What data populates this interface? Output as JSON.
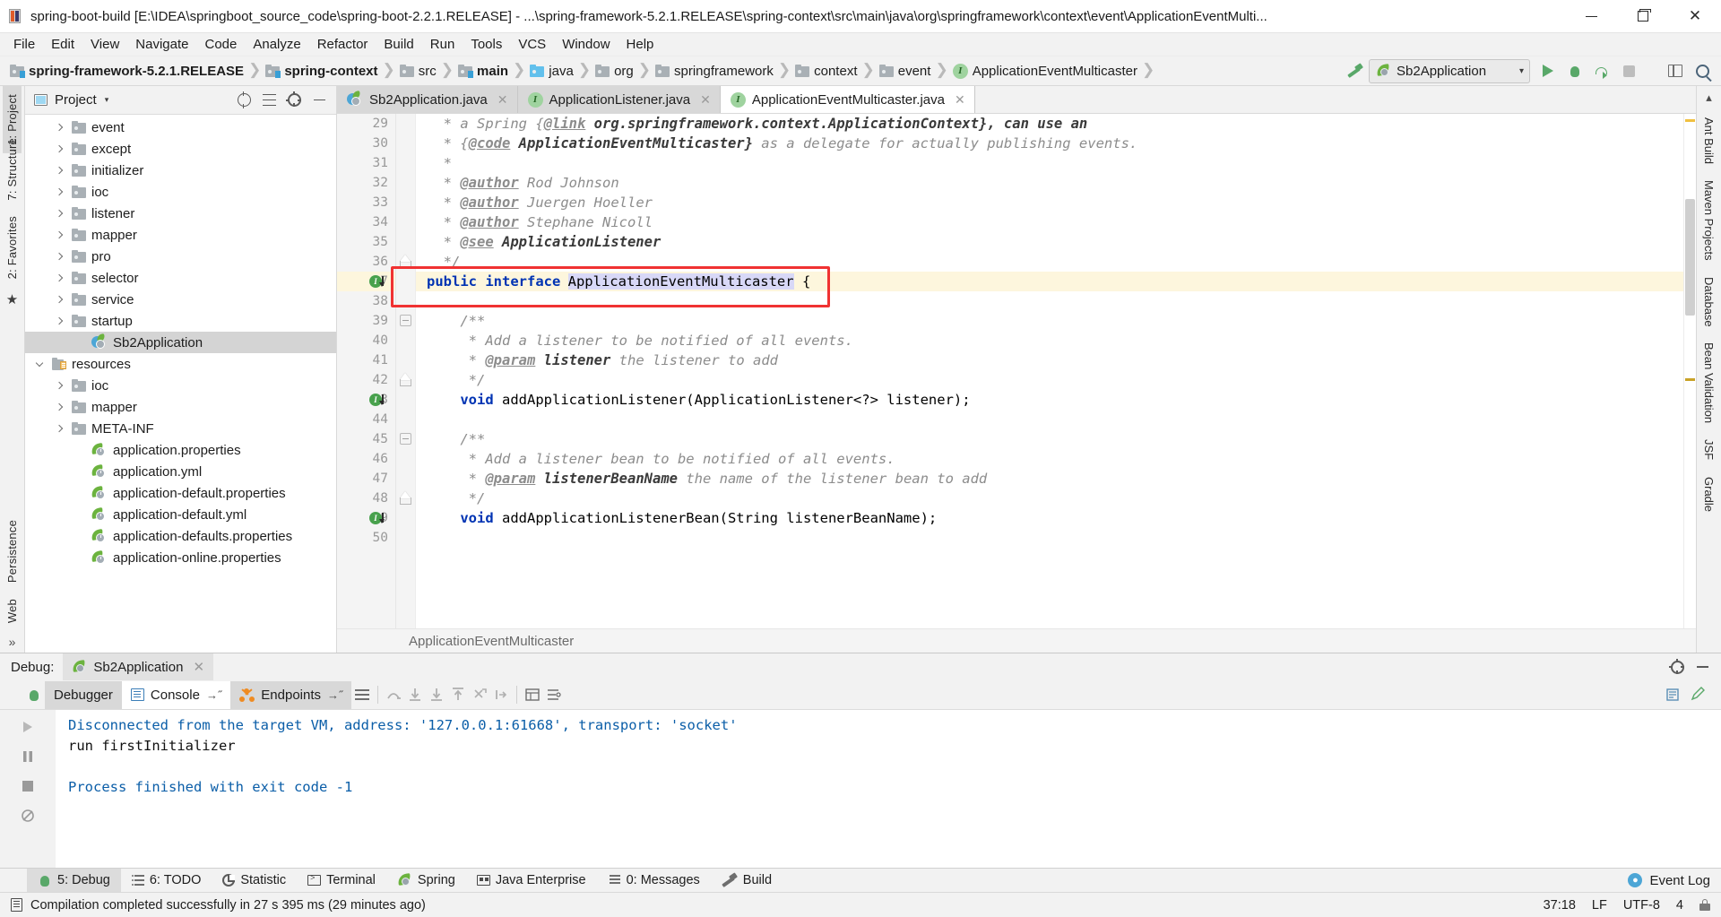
{
  "window": {
    "title": "spring-boot-build [E:\\IDEA\\springboot_source_code\\spring-boot-2.2.1.RELEASE] - ...\\spring-framework-5.2.1.RELEASE\\spring-context\\src\\main\\java\\org\\springframework\\context\\event\\ApplicationEventMulti...",
    "icon": "intellij-idea-icon",
    "minimize": "─",
    "maximize": "❐",
    "close": "✕"
  },
  "menubar": {
    "items": [
      "File",
      "Edit",
      "View",
      "Navigate",
      "Code",
      "Analyze",
      "Refactor",
      "Build",
      "Run",
      "Tools",
      "VCS",
      "Window",
      "Help"
    ]
  },
  "breadcrumb": {
    "items": [
      {
        "label": "spring-framework-5.2.1.RELEASE",
        "icon": "module-folder-icon",
        "bold": true
      },
      {
        "label": "spring-context",
        "icon": "module-folder-icon",
        "bold": true
      },
      {
        "label": "src",
        "icon": "folder-icon",
        "bold": false
      },
      {
        "label": "main",
        "icon": "module-folder-icon",
        "bold": true
      },
      {
        "label": "java",
        "icon": "source-root-folder-icon",
        "bold": false
      },
      {
        "label": "org",
        "icon": "folder-icon",
        "bold": false
      },
      {
        "label": "springframework",
        "icon": "folder-icon",
        "bold": false
      },
      {
        "label": "context",
        "icon": "folder-icon",
        "bold": false
      },
      {
        "label": "event",
        "icon": "folder-icon",
        "bold": false
      },
      {
        "label": "ApplicationEventMulticaster",
        "icon": "interface-icon",
        "bold": false
      }
    ],
    "separator": "❯"
  },
  "toolbar": {
    "build_icon": "hammer-build-icon",
    "run_config": {
      "label": "Sb2Application",
      "icon": "spring-boot-icon",
      "chevron": "▾"
    },
    "run_icon": "run-icon",
    "debug_icon": "debug-icon",
    "rerun_icon": "rerun-icon",
    "stop_icon": "stop-icon",
    "layout_icon": "layout-icon",
    "search_icon": "search-everywhere-icon"
  },
  "project_panel": {
    "title": "Project",
    "chevron": "▾",
    "window_icon": "project-window-icon",
    "locate_icon": "scroll-from-source-icon",
    "collapse_icon": "collapse-all-icon",
    "hide_icon": "hide-panel-icon",
    "tree": [
      {
        "label": "event",
        "icon": "folder-icon",
        "arrow": "right",
        "indent": 3,
        "selected": false
      },
      {
        "label": "except",
        "icon": "folder-icon",
        "arrow": "right",
        "indent": 3,
        "selected": false
      },
      {
        "label": "initializer",
        "icon": "folder-icon",
        "arrow": "right",
        "indent": 3,
        "selected": false
      },
      {
        "label": "ioc",
        "icon": "folder-icon",
        "arrow": "right",
        "indent": 3,
        "selected": false
      },
      {
        "label": "listener",
        "icon": "folder-icon",
        "arrow": "right",
        "indent": 3,
        "selected": false
      },
      {
        "label": "mapper",
        "icon": "folder-icon",
        "arrow": "right",
        "indent": 3,
        "selected": false
      },
      {
        "label": "pro",
        "icon": "folder-icon",
        "arrow": "right",
        "indent": 3,
        "selected": false
      },
      {
        "label": "selector",
        "icon": "folder-icon",
        "arrow": "right",
        "indent": 3,
        "selected": false
      },
      {
        "label": "service",
        "icon": "folder-icon",
        "arrow": "right",
        "indent": 3,
        "selected": false
      },
      {
        "label": "startup",
        "icon": "folder-icon",
        "arrow": "right",
        "indent": 3,
        "selected": false
      },
      {
        "label": "Sb2Application",
        "icon": "spring-boot-class-icon",
        "arrow": "none",
        "indent": 4,
        "selected": true
      },
      {
        "label": "resources",
        "icon": "resources-folder-icon",
        "arrow": "down",
        "indent": 2,
        "selected": false
      },
      {
        "label": "ioc",
        "icon": "folder-icon",
        "arrow": "right",
        "indent": 3,
        "selected": false
      },
      {
        "label": "mapper",
        "icon": "folder-icon",
        "arrow": "right",
        "indent": 3,
        "selected": false
      },
      {
        "label": "META-INF",
        "icon": "folder-icon",
        "arrow": "right",
        "indent": 3,
        "selected": false
      },
      {
        "label": "application.properties",
        "icon": "spring-config-icon",
        "arrow": "none",
        "indent": 4,
        "selected": false
      },
      {
        "label": "application.yml",
        "icon": "spring-config-icon",
        "arrow": "none",
        "indent": 4,
        "selected": false
      },
      {
        "label": "application-default.properties",
        "icon": "spring-config-icon",
        "arrow": "none",
        "indent": 4,
        "selected": false
      },
      {
        "label": "application-default.yml",
        "icon": "spring-config-icon",
        "arrow": "none",
        "indent": 4,
        "selected": false
      },
      {
        "label": "application-defaults.properties",
        "icon": "spring-config-icon",
        "arrow": "none",
        "indent": 4,
        "selected": false
      },
      {
        "label": "application-online.properties",
        "icon": "spring-config-icon",
        "arrow": "none",
        "indent": 4,
        "selected": false
      }
    ]
  },
  "left_strip": {
    "top": [
      {
        "label": "1: Project",
        "icon": "project-icon",
        "active": true
      }
    ],
    "bottom": [
      {
        "label": "2: Favorites",
        "icon": "favorites-icon",
        "active": false
      },
      {
        "label": "7: Structure",
        "icon": "structure-icon",
        "active": false
      }
    ]
  },
  "left_strip_lower": [
    {
      "label": "Persistence",
      "icon": "persistence-icon"
    },
    {
      "label": "Web",
      "icon": "web-icon"
    }
  ],
  "right_strip": [
    {
      "label": "Ant Build",
      "icon": "ant-icon"
    },
    {
      "label": "Maven Projects",
      "icon": "maven-icon"
    },
    {
      "label": "Database",
      "icon": "database-icon"
    },
    {
      "label": "Bean Validation",
      "icon": "bean-validation-icon"
    },
    {
      "label": "JSF",
      "icon": "jsf-icon"
    },
    {
      "label": "Gradle",
      "icon": "gradle-icon"
    }
  ],
  "editor": {
    "tabs": [
      {
        "label": "Sb2Application.java",
        "icon": "spring-boot-class-icon",
        "active": false,
        "close": "✕"
      },
      {
        "label": "ApplicationListener.java",
        "icon": "interface-icon",
        "active": false,
        "close": "✕"
      },
      {
        "label": "ApplicationEventMulticaster.java",
        "icon": "interface-icon",
        "active": true,
        "close": "✕"
      }
    ],
    "first_line_number": 29,
    "lines": [
      {
        "n": 29,
        "html": "  <span class='cm'>* a Spring {</span><span class='tag'>@link</span><span class='cmb'> org.springframework.context.ApplicationContext}, can use an</span>",
        "highlight": false,
        "gutter": ""
      },
      {
        "n": 30,
        "html": "  <span class='cm'>* {</span><span class='tag'>@code</span><span class='cmb'> ApplicationEventMulticaster}</span><span class='cm'> as a delegate for actually publishing events.</span>",
        "highlight": false,
        "gutter": ""
      },
      {
        "n": 31,
        "html": "  <span class='cm'>*</span>",
        "highlight": false,
        "gutter": ""
      },
      {
        "n": 32,
        "html": "  <span class='cm'>* </span><span class='tag'>@author</span><span class='cm'> Rod Johnson</span>",
        "highlight": false,
        "gutter": ""
      },
      {
        "n": 33,
        "html": "  <span class='cm'>* </span><span class='tag'>@author</span><span class='cm'> Juergen Hoeller</span>",
        "highlight": false,
        "gutter": ""
      },
      {
        "n": 34,
        "html": "  <span class='cm'>* </span><span class='tag'>@author</span><span class='cm'> Stephane Nicoll</span>",
        "highlight": false,
        "gutter": ""
      },
      {
        "n": 35,
        "html": "  <span class='cm'>* </span><span class='tag'>@see</span><span class='cmb'> ApplicationListener</span>",
        "highlight": false,
        "gutter": ""
      },
      {
        "n": 36,
        "html": "  <span class='cm'>*/</span>",
        "highlight": false,
        "gutter": "foldB"
      },
      {
        "n": 37,
        "html": "<span class='kw'>public interface </span><span class='caret'></span><span class='ident-hl'>ApplicationEventMulticaster</span> {",
        "highlight": true,
        "gutter": "impl"
      },
      {
        "n": 38,
        "html": "",
        "highlight": false,
        "gutter": ""
      },
      {
        "n": 39,
        "html": "    <span class='cm'>/**</span>",
        "highlight": false,
        "gutter": "foldT"
      },
      {
        "n": 40,
        "html": "     <span class='cm'>* Add a listener to be notified of all events.</span>",
        "highlight": false,
        "gutter": ""
      },
      {
        "n": 41,
        "html": "     <span class='cm'>* </span><span class='tag'>@param</span><span class='cmb'> listener</span><span class='cm'> the listener to add</span>",
        "highlight": false,
        "gutter": ""
      },
      {
        "n": 42,
        "html": "     <span class='cm'>*/</span>",
        "highlight": false,
        "gutter": "foldB"
      },
      {
        "n": 43,
        "html": "    <span class='kw'>void </span>addApplicationListener(ApplicationListener&lt;?&gt; listener);",
        "highlight": false,
        "gutter": "impl"
      },
      {
        "n": 44,
        "html": "",
        "highlight": false,
        "gutter": ""
      },
      {
        "n": 45,
        "html": "    <span class='cm'>/**</span>",
        "highlight": false,
        "gutter": "foldT"
      },
      {
        "n": 46,
        "html": "     <span class='cm'>* Add a listener bean to be notified of all events.</span>",
        "highlight": false,
        "gutter": ""
      },
      {
        "n": 47,
        "html": "     <span class='cm'>* </span><span class='tag'>@param</span><span class='cmb'> listenerBeanName</span><span class='cm'> the name of the listener bean to add</span>",
        "highlight": false,
        "gutter": ""
      },
      {
        "n": 48,
        "html": "     <span class='cm'>*/</span>",
        "highlight": false,
        "gutter": "foldB"
      },
      {
        "n": 49,
        "html": "    <span class='kw'>void </span>addApplicationListenerBean(String listenerBeanName);",
        "highlight": false,
        "gutter": "impl"
      },
      {
        "n": 50,
        "html": "",
        "highlight": false,
        "gutter": ""
      }
    ],
    "breadcrumb_bottom": "ApplicationEventMulticaster",
    "highlight_box_color": "#f03232",
    "implemented_marker": "I"
  },
  "debug": {
    "label": "Debug:",
    "session_tab": {
      "label": "Sb2Application",
      "icon": "spring-boot-icon",
      "close": "✕"
    },
    "settings_icon": "settings-icon",
    "hide_icon": "hide-icon",
    "tabs": [
      {
        "label": "Debugger",
        "icon": "",
        "state": "sel"
      },
      {
        "label": "Console",
        "icon": "console-icon",
        "state": "white",
        "pin": "→˝"
      },
      {
        "label": "Endpoints",
        "icon": "endpoints-icon",
        "state": "sel",
        "pin": "→˝"
      }
    ],
    "console_lines": [
      {
        "text": "Disconnected from the target VM, address: '127.0.0.1:61668', transport: 'socket'",
        "color": "blue"
      },
      {
        "text": "run firstInitializer",
        "color": "black"
      },
      {
        "text": "",
        "color": "black"
      },
      {
        "text": "Process finished with exit code -1",
        "color": "blue"
      }
    ],
    "side_icons": [
      "debug-icon",
      "rerun-icon",
      "resume-icon",
      "stop-icon",
      "mute-breakpoints-icon"
    ]
  },
  "bottom_tabs": [
    {
      "label": "5: Debug",
      "icon": "debug-icon",
      "active": true
    },
    {
      "label": "6: TODO",
      "icon": "todo-icon",
      "active": false
    },
    {
      "label": "Statistic",
      "icon": "statistic-icon",
      "active": false
    },
    {
      "label": "Terminal",
      "icon": "terminal-icon",
      "active": false
    },
    {
      "label": "Spring",
      "icon": "spring-icon",
      "active": false
    },
    {
      "label": "Java Enterprise",
      "icon": "java-enterprise-icon",
      "active": false
    },
    {
      "label": "0: Messages",
      "icon": "messages-icon",
      "active": false
    },
    {
      "label": "Build",
      "icon": "build-icon",
      "active": false
    }
  ],
  "bottom_right": {
    "event_log": "Event Log",
    "event_log_icon": "event-log-icon"
  },
  "statusbar": {
    "message": "Compilation completed successfully in 27 s 395 ms (29 minutes ago)",
    "message_icon": "notification-icon",
    "caret_position": "37:18",
    "line_separator": "LF",
    "encoding": "UTF-8",
    "indent": "4",
    "lock_icon": "write-lock-icon"
  },
  "colors": {
    "accent_green": "#59a869",
    "highlight_yellow": "#fdf6dd",
    "selection_blue": "#d8d8f7",
    "red_box": "#f03232",
    "keyword_blue": "#0033b3"
  }
}
